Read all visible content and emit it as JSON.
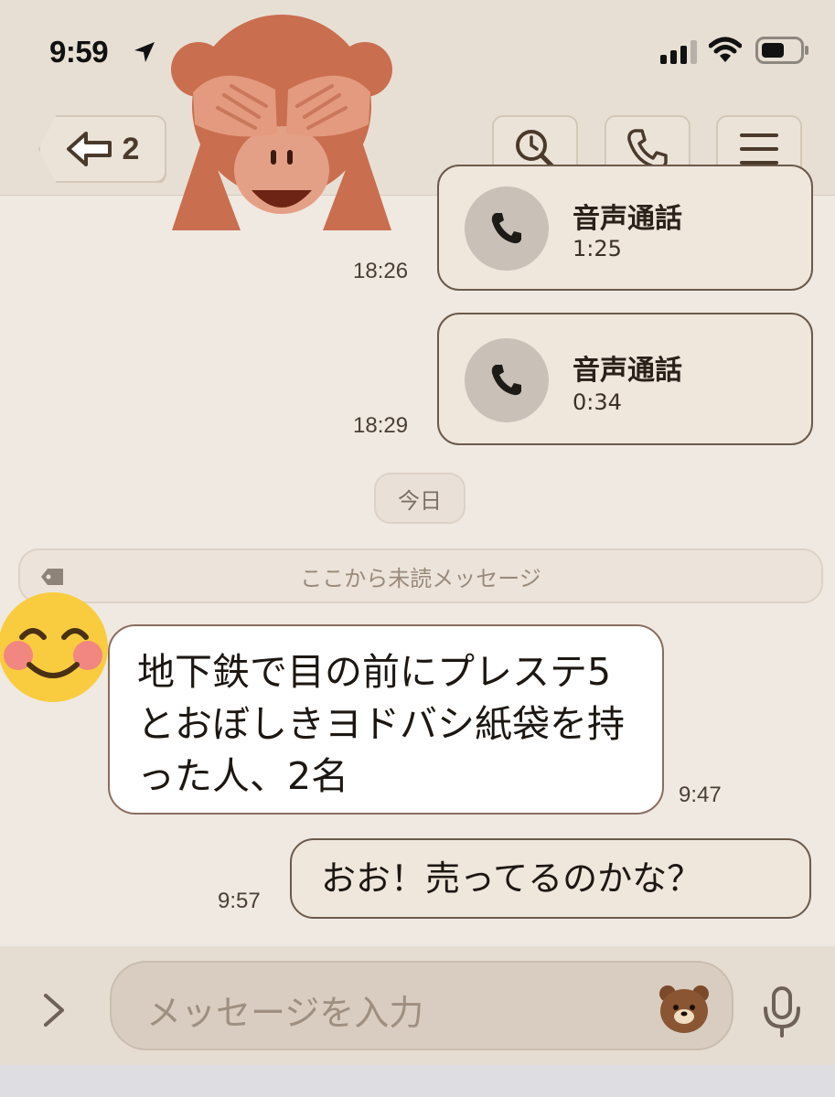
{
  "status_bar": {
    "time": "9:59"
  },
  "header": {
    "back_count": "2"
  },
  "messages": {
    "call1": {
      "title": "音声通話",
      "duration": "1:25",
      "time": "18:26"
    },
    "call2": {
      "title": "音声通話",
      "duration": "0:34",
      "time": "18:29"
    },
    "date_divider": "今日",
    "unread_divider": "ここから未読メッセージ",
    "incoming": {
      "text": "地下鉄で目の前にプレステ5とおぼしきヨドバシ紙袋を持った人、2名",
      "time": "9:47"
    },
    "outgoing": {
      "text": "おお！売ってるのかな？",
      "time": "9:57"
    }
  },
  "composer": {
    "placeholder": "メッセージを入力"
  },
  "colors": {
    "bubble_border": "#6b5a4b",
    "background": "#efe9e2",
    "header": "#e8dfd4"
  }
}
